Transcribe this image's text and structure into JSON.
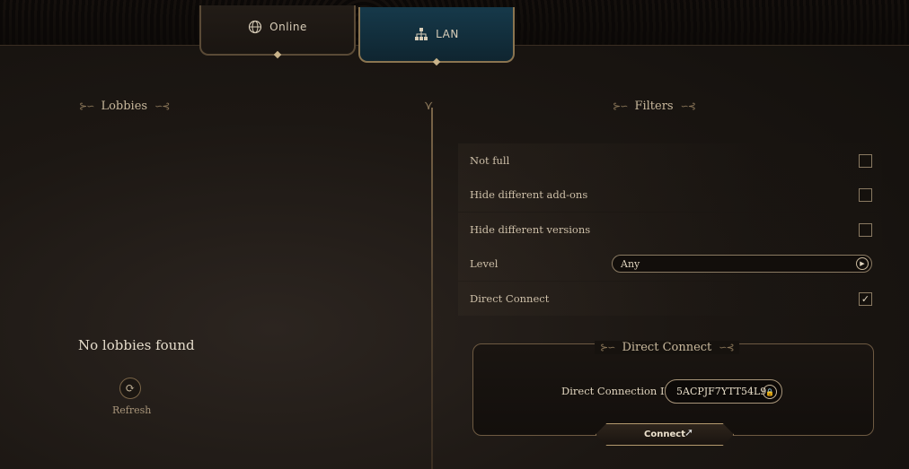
{
  "tabs": {
    "online": {
      "label": "Online",
      "icon": "globe-icon"
    },
    "lan": {
      "label": "LAN",
      "icon": "network-icon",
      "active": true
    }
  },
  "lobbies": {
    "title": "Lobbies",
    "empty_text": "No lobbies found",
    "refresh_label": "Refresh"
  },
  "filters": {
    "title": "Filters",
    "rows": [
      {
        "label": "Not full",
        "checked": false
      },
      {
        "label": "Hide different add-ons",
        "checked": false
      },
      {
        "label": "Hide different versions",
        "checked": false
      },
      {
        "label": "Level",
        "value": "Any"
      },
      {
        "label": "Direct Connect",
        "checked": true
      }
    ]
  },
  "direct_connect": {
    "title": "Direct Connect",
    "id_label": "Direct Connection ID",
    "id_value": "5ACPJF7YTT54L9",
    "connect_label": "Connect"
  },
  "colors": {
    "accent": "#c8b89c",
    "lan_tab": "#16394a",
    "border": "#8a7a62"
  }
}
